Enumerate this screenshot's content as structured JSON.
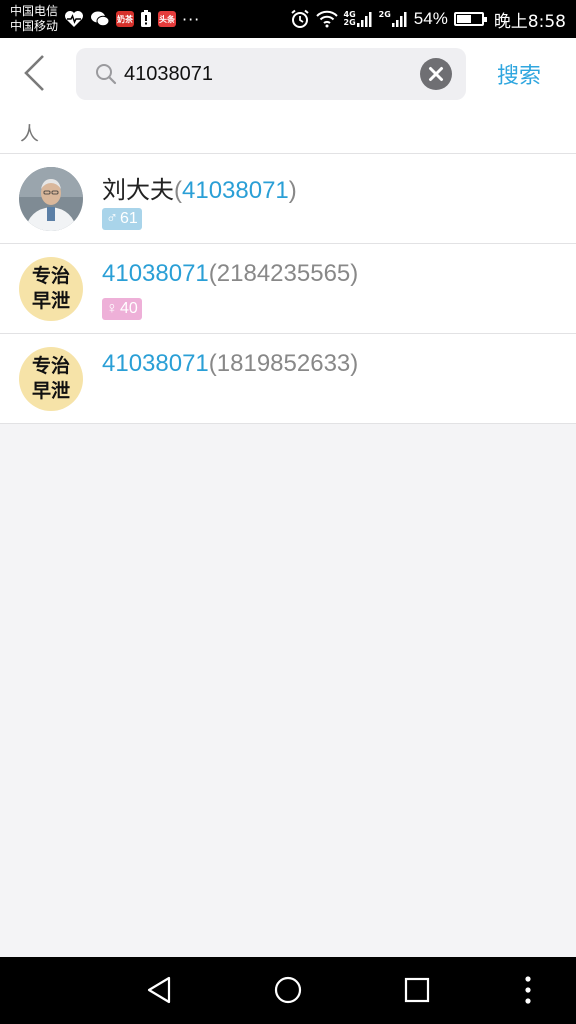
{
  "status_bar": {
    "carrier1": "中国电信",
    "carrier2": "中国移动",
    "app_icon_1": "奶茶",
    "app_icon_2": "头条",
    "net1_top": "4G",
    "net1_bottom": "2G",
    "net2": "2G",
    "battery": "54%",
    "time": "晚上8:58"
  },
  "search": {
    "query": "41038071",
    "button_label": "搜索"
  },
  "section": {
    "title": "人"
  },
  "results": [
    {
      "name_main": "刘大夫",
      "open": "(",
      "id_hl": "41038071",
      "close": ")",
      "gender_symbol": "♂",
      "age": "61",
      "tag": "male"
    },
    {
      "name_main": "41038071",
      "open": "(",
      "id_plain": "2184235565",
      "close": ")",
      "gender_symbol": "♀",
      "age": "40",
      "tag": "female",
      "avatar_line1": "专治",
      "avatar_line2": "早泄"
    },
    {
      "name_main": "41038071",
      "open": "(",
      "id_plain": "1819852633",
      "close": ")",
      "avatar_line1": "专治",
      "avatar_line2": "早泄"
    }
  ],
  "colors": {
    "accent": "#2a9fd6",
    "male_tag": "#a9d4ea",
    "female_tag": "#eeb0d8",
    "badge_avatar": "#f6e3a8"
  },
  "icons": {
    "back": "chevron-left-icon",
    "search": "search-icon",
    "clear": "close-circle-icon",
    "nav_back": "triangle-back-icon",
    "nav_home": "circle-home-icon",
    "nav_recent": "square-recent-icon",
    "nav_more": "dots-more-icon"
  }
}
